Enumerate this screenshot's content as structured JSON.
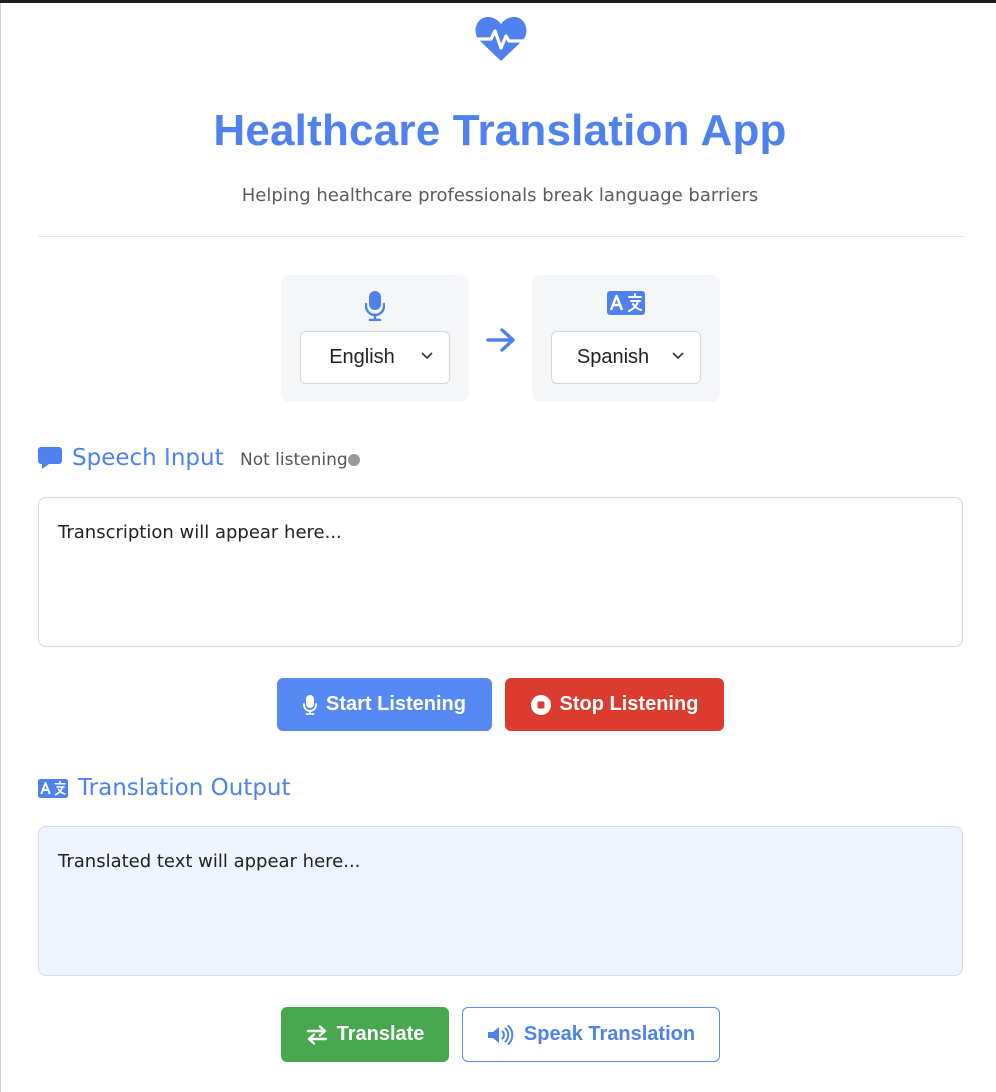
{
  "app": {
    "title": "Healthcare Translation App",
    "subtitle": "Helping healthcare professionals break language barriers",
    "logo_icon": "heart-pulse-icon",
    "accent_color": "#4f82ee"
  },
  "languages": {
    "source": {
      "icon": "microphone-icon",
      "selected": "English",
      "options": [
        "English"
      ]
    },
    "target": {
      "icon": "translate-icon",
      "selected": "Spanish",
      "options": [
        "Spanish"
      ]
    },
    "arrow_icon": "arrow-right-icon"
  },
  "speech_input": {
    "heading": "Speech Input",
    "icon": "comment-icon",
    "status": "Not listening",
    "status_color": "#9a9a9a",
    "transcript_placeholder": "Transcription will appear here..."
  },
  "controls": {
    "start_label": "Start Listening",
    "start_color": "#5789f2",
    "stop_label": "Stop Listening",
    "stop_color": "#db3c2f"
  },
  "translation_output": {
    "heading": "Translation Output",
    "icon": "translate-icon",
    "placeholder": "Translated text will appear here..."
  },
  "actions": {
    "translate_label": "Translate",
    "translate_color": "#47a84f",
    "speak_label": "Speak Translation"
  }
}
